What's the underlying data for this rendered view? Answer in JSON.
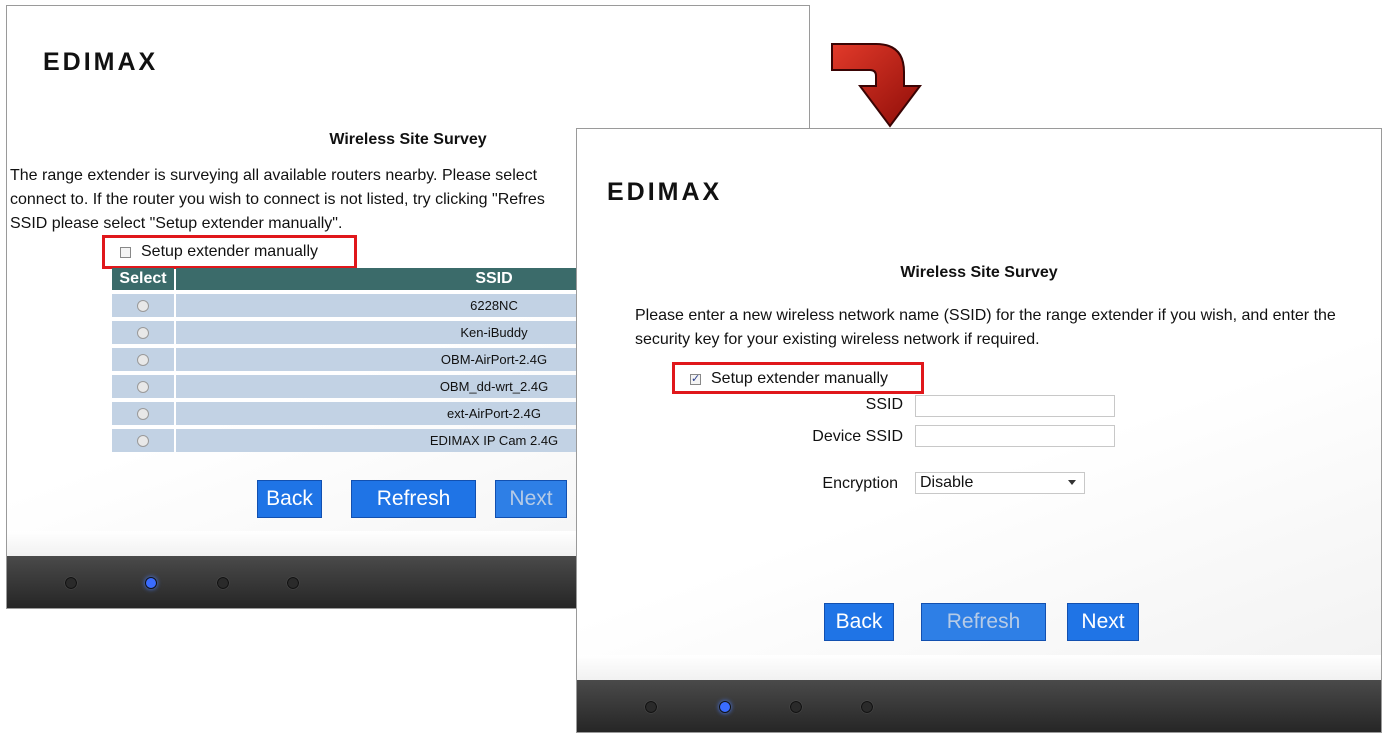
{
  "brand": {
    "logo_text": "EDIMAX"
  },
  "panel_a": {
    "title": "Wireless Site Survey",
    "description_lines": [
      "The range extender is surveying all available routers nearby. Please select",
      "connect to. If the router you wish to connect is not listed, try clicking \"Refres",
      "SSID please select \"Setup extender manually\"."
    ],
    "manual_label": "Setup extender manually",
    "manual_checked": false,
    "table": {
      "headers": [
        "Select",
        "SSID"
      ],
      "rows": [
        "6228NC",
        "Ken-iBuddy",
        "OBM-AirPort-2.4G",
        "OBM_dd-wrt_2.4G",
        "ext-AirPort-2.4G",
        "EDIMAX IP Cam 2.4G"
      ]
    },
    "buttons": {
      "back": "Back",
      "refresh": "Refresh",
      "next": "Next"
    }
  },
  "panel_b": {
    "title": "Wireless Site Survey",
    "description_lines": [
      "Please enter a new wireless network name (SSID) for the range extender if you wish, and enter the",
      "security key for your existing wireless network if required."
    ],
    "manual_label": "Setup extender manually",
    "manual_checked": true,
    "ssid_label": "SSID",
    "ssid_value": "",
    "device_ssid_label": "Device SSID",
    "device_ssid_value": "",
    "encryption_label": "Encryption",
    "encryption_value": "Disable",
    "buttons": {
      "back": "Back",
      "refresh": "Refresh",
      "next": "Next"
    }
  },
  "colors": {
    "button_blue": "#1f74e6",
    "table_header": "#3b6b6a",
    "table_row": "#c2d2e4",
    "highlight_red": "#e0171b",
    "arrow_red": "#c0140f",
    "led_active": "#3a6cff"
  },
  "icons": [
    "curved-arrow-icon",
    "checkbox-icon",
    "radio-icon",
    "dropdown-arrow-icon",
    "status-led-icon"
  ]
}
